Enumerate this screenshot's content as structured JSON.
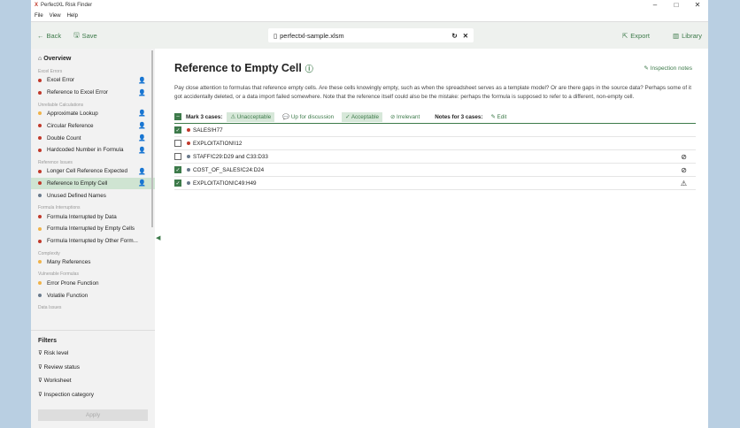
{
  "app": {
    "title": "PerfectXL Risk Finder",
    "menu": [
      "File",
      "View",
      "Help"
    ]
  },
  "toolbar": {
    "back": "Back",
    "save": "Save",
    "file": "perfectxl-sample.xlsm",
    "export": "Export",
    "library": "Library"
  },
  "sidebar": {
    "overview": "Overview",
    "groups": [
      {
        "label": "Excel Errors",
        "items": [
          {
            "label": "Excel Error",
            "color": "#c0392b"
          },
          {
            "label": "Reference to Excel Error",
            "color": "#c0392b"
          }
        ]
      },
      {
        "label": "Unreliable Calculations",
        "items": [
          {
            "label": "Approximate Lookup",
            "color": "#f0b34a"
          },
          {
            "label": "Circular Reference",
            "color": "#c0392b"
          },
          {
            "label": "Double Count",
            "color": "#c0392b"
          },
          {
            "label": "Hardcoded Number in Formula",
            "color": "#c0392b"
          }
        ]
      },
      {
        "label": "Reference Issues",
        "items": [
          {
            "label": "Longer Cell Reference Expected",
            "color": "#c0392b"
          },
          {
            "label": "Reference to Empty Cell",
            "color": "#c0392b"
          },
          {
            "label": "Unused Defined Names",
            "color": "#6a7a8c"
          }
        ]
      },
      {
        "label": "Formula Interruptions",
        "items": [
          {
            "label": "Formula Interrupted by Data",
            "color": "#c0392b"
          },
          {
            "label": "Formula Interrupted by Empty Cells",
            "color": "#f0b34a"
          },
          {
            "label": "Formula Interrupted by Other Form...",
            "color": "#c0392b"
          }
        ]
      },
      {
        "label": "Complexity",
        "items": [
          {
            "label": "Many References",
            "color": "#f0b34a"
          }
        ]
      },
      {
        "label": "Vulnerable Formulas",
        "items": [
          {
            "label": "Error Prone Function",
            "color": "#f0b34a"
          },
          {
            "label": "Volatile Function",
            "color": "#6a7a8c"
          }
        ]
      },
      {
        "label": "Data Issues",
        "items": []
      }
    ],
    "filters": {
      "title": "Filters",
      "items": [
        "Risk level",
        "Review status",
        "Worksheet",
        "Inspection category"
      ],
      "apply": "Apply"
    }
  },
  "main": {
    "title": "Reference to Empty Cell",
    "inspection_notes": "Inspection notes",
    "description": "Pay close attention to formulas that reference empty cells. Are these cells knowingly empty, such as when the spreadsheet serves as a template model? Or are there gaps in the source data? Perhaps some of it got accidentally deleted, or a data import failed somewhere. Note that the reference itself could also be the mistake: perhaps the formula is supposed to refer to a different, non-empty cell.",
    "mark_label": "Mark 3 cases:",
    "marks": [
      "Unacceptable",
      "Up for discussion",
      "Acceptable",
      "Irrelevant"
    ],
    "notes_label": "Notes for 3 cases:",
    "edit": "Edit",
    "rows": [
      {
        "label": "SALES!H77",
        "checked": true,
        "color": "#c0392b",
        "status": ""
      },
      {
        "label": "EXPLOITATION!I12",
        "checked": false,
        "color": "#c0392b",
        "status": ""
      },
      {
        "label": "STAFF!C29:D29 and C33:D33",
        "checked": false,
        "color": "#6a7a8c",
        "status": "⊘"
      },
      {
        "label": "COST_OF_SALES!C24:D24",
        "checked": true,
        "color": "#6a7a8c",
        "status": "⊘"
      },
      {
        "label": "EXPLOITATION!C49:H49",
        "checked": true,
        "color": "#6a7a8c",
        "status": "⚠"
      }
    ]
  }
}
